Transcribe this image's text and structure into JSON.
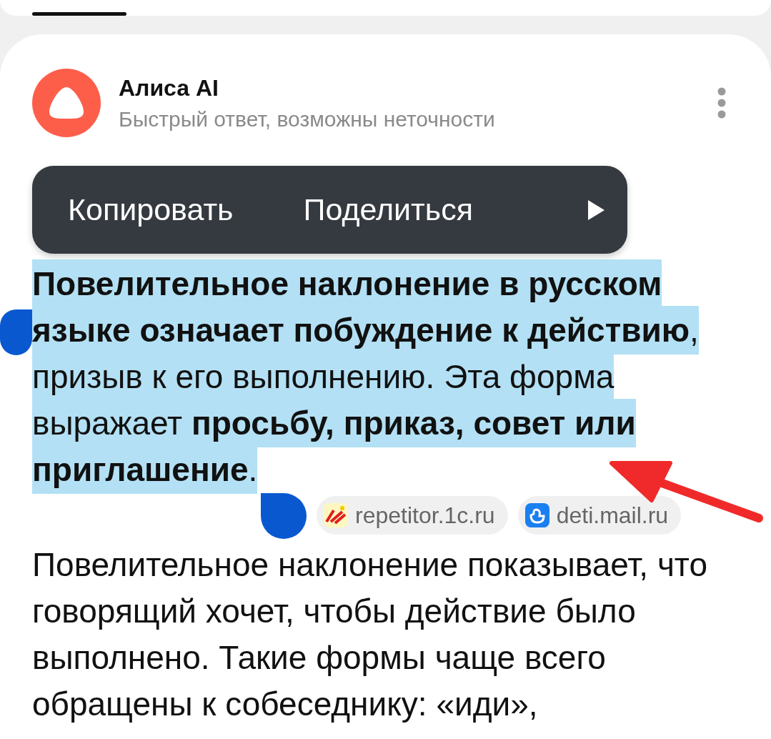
{
  "assistant": {
    "name": "Алиса AI",
    "subtitle": "Быстрый ответ, возможны неточности"
  },
  "context_menu": {
    "items": [
      "Копировать",
      "Поделиться"
    ]
  },
  "answer": {
    "paragraphs": [
      {
        "text": "**Повелительное наклонение в русском языке означает побуждение к действию**, призыв к его выполнению. Эта форма выражает **просьбу, приказ, совет или приглашение**.",
        "selected": true,
        "sources": [
          {
            "label": "repetitor.1c.ru",
            "kind": "onec"
          },
          {
            "label": "deti.mail.ru",
            "kind": "duck"
          }
        ]
      },
      {
        "text": "Повелительное наклонение показывает, что говорящий хочет, чтобы действие было выполнено. Такие формы чаще всего обращены к собеседнику: «иди»,",
        "selected": false
      }
    ]
  }
}
